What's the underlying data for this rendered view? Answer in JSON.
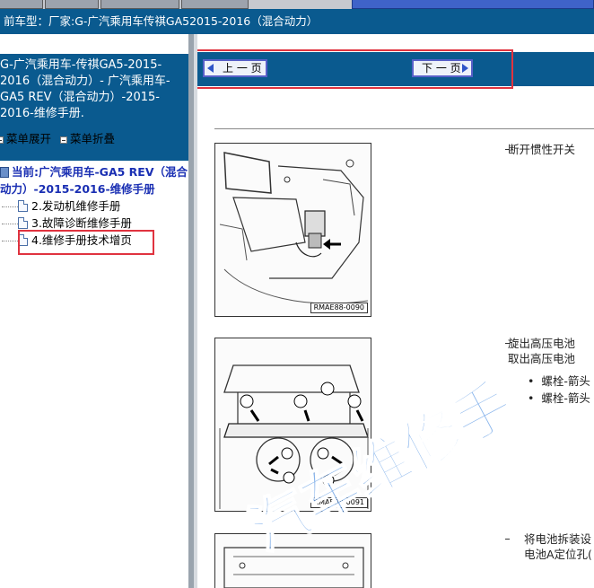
{
  "window": {
    "title": "前车型：厂家:G-广汽乘用车传祺GA52015-2016（混合动力）"
  },
  "sidebar": {
    "header_text": "G-广汽乘用车-传祺GA5-2015-\n2016（混合动力）- 广汽乘用车-\nGA5 REV（混合动力）-2015-\n2016-维修手册.",
    "expand_label": "菜单展开",
    "collapse_label": "菜单折叠",
    "tree_root": "当前:广汽乘用车-GA5 REV（混合\n动力）-2015-2016-维修手册",
    "items": [
      {
        "label": "2.发动机维修手册"
      },
      {
        "label": "3.故障诊断维修手册"
      },
      {
        "label": "4.维修手册技术增页"
      }
    ]
  },
  "nav": {
    "prev_label": "上 一 页",
    "next_label": "下 一 页"
  },
  "content": {
    "figures": [
      {
        "code": "RMAE88-0090"
      },
      {
        "code": "RMAE88-0091"
      }
    ],
    "step1": "断开惯性开关",
    "step2_line1": "旋出高压电池",
    "step2_line2": "取出高压电池",
    "bullet1": "螺栓-箭头",
    "bullet2": "螺栓-箭头",
    "step3_line1": "将电池拆装设",
    "step3_line2": "电池A定位孔(",
    "bullet_char": "•",
    "dash_char": "–"
  },
  "watermark": {
    "text": "汽车维修手"
  },
  "colors": {
    "title_bg": "#0a5a8f",
    "highlight": "#e0333f",
    "tree_root": "#1a2fb3"
  }
}
